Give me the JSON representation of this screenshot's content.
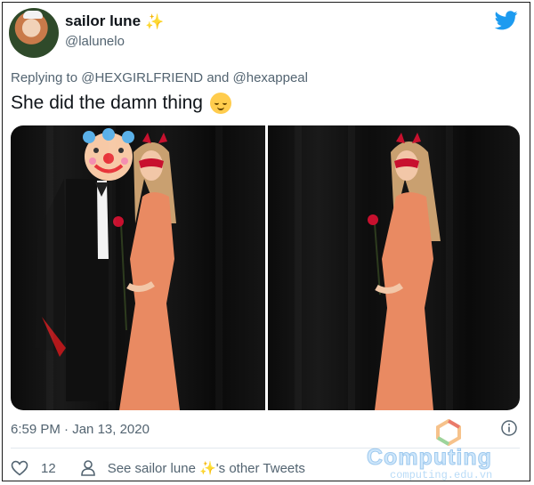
{
  "tweet": {
    "display_name": "sailor lune",
    "handle": "@lalunelo",
    "reply_prefix": "Replying to",
    "reply_to_1": "@HEXGIRLFRIEND",
    "reply_and": "and",
    "reply_to_2": "@hexappeal",
    "text": "She did the damn thing",
    "time": "6:59 PM",
    "dot": "·",
    "date": "Jan 13, 2020",
    "like_count": "12",
    "see_tweets_prefix": "See sailor lune",
    "see_tweets_suffix": "'s other Tweets",
    "sparkle": "✨"
  },
  "photos": [
    {
      "alt_name": "costume-photo-couple"
    },
    {
      "alt_name": "costume-photo-single"
    }
  ],
  "icons": {
    "brand": "twitter-bird-icon",
    "info": "info-icon",
    "like": "heart-icon",
    "profile": "person-icon",
    "name_emoji": "sparkle-icon",
    "text_emoji": "relieved-face-emoji"
  },
  "colors": {
    "twitter_blue": "#1d9bf0",
    "secondary_text": "#536471",
    "dress": "#e98a62",
    "mask_red": "#c8102e"
  },
  "watermark": {
    "title": "Computing",
    "subtitle": "computing.edu.vn"
  }
}
